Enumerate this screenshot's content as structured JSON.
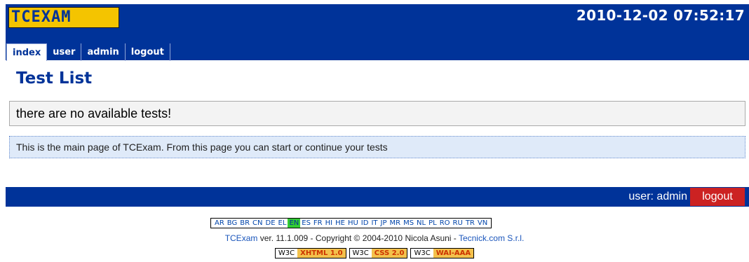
{
  "header": {
    "logo_text": "TCEXAM",
    "datetime": "2010-12-02 07:52:17",
    "menu": [
      {
        "label": "index",
        "active": true
      },
      {
        "label": "user",
        "active": false
      },
      {
        "label": "admin",
        "active": false
      },
      {
        "label": "logout",
        "active": false
      }
    ]
  },
  "main": {
    "title": "Test List",
    "warning": "there are no available tests!",
    "help": "This is the main page of TCExam. From this page you can start or continue your tests"
  },
  "userbar": {
    "user_label": "user: admin",
    "logout_label": "logout"
  },
  "footer": {
    "languages": [
      "AR",
      "BG",
      "BR",
      "CN",
      "DE",
      "EL",
      "EN",
      "ES",
      "FR",
      "HI",
      "HE",
      "HU",
      "ID",
      "IT",
      "JP",
      "MR",
      "MS",
      "NL",
      "PL",
      "RO",
      "RU",
      "TR",
      "VN"
    ],
    "active_language": "EN",
    "copyright_app": "TCExam",
    "copyright_middle": " ver. 11.1.009 - Copyright © 2004-2010 Nicola Asuni - ",
    "copyright_company": "Tecnick.com S.r.l.",
    "badges": [
      {
        "left": "W3C",
        "right": "XHTML 1.0"
      },
      {
        "left": "W3C",
        "right": "CSS 2.0"
      },
      {
        "left": "W3C",
        "right": "WAI-AAA"
      }
    ]
  },
  "colors": {
    "brand_blue": "#003399",
    "logo_yellow": "#f4c400",
    "logout_red": "#cc2222",
    "active_lang_green": "#33cc33"
  }
}
